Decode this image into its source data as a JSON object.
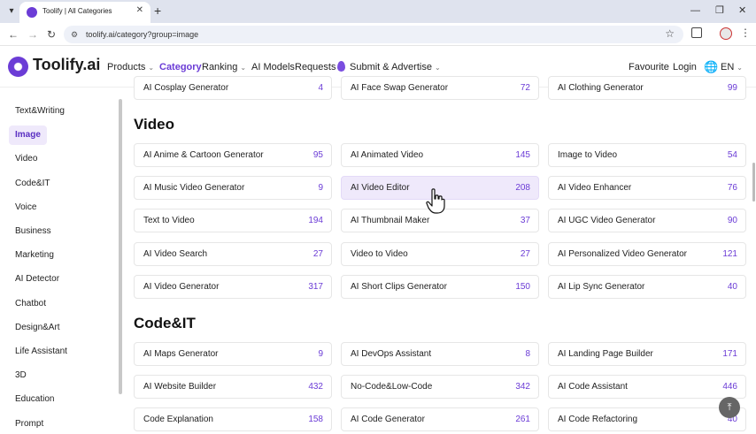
{
  "browser": {
    "tab_title": "Toolify | All Categories",
    "url": "toolify.ai/category?group=image",
    "icons": {
      "tab_menu": "chevron-down-icon",
      "close": "close-icon",
      "new_tab": "plus-icon",
      "back": "arrow-left-icon",
      "forward": "arrow-right-icon",
      "reload": "reload-icon",
      "site_info": "tune-icon",
      "bookmark": "star-icon",
      "extensions": "puzzle-icon",
      "menu": "kebab-icon"
    }
  },
  "header": {
    "logo_text": "Toolify.ai",
    "nav": {
      "products": "Products",
      "category": "Category",
      "ranking": "Ranking",
      "ai_models": "AI Models",
      "requests": "Requests",
      "submit": "Submit & Advertise"
    },
    "favourite": "Favourite",
    "login": "Login",
    "language": "EN",
    "accent_color": "#6b3cd6"
  },
  "sidebar": {
    "items": [
      {
        "label": "Text&Writing",
        "active": false
      },
      {
        "label": "Image",
        "active": true
      },
      {
        "label": "Video",
        "active": false
      },
      {
        "label": "Code&IT",
        "active": false
      },
      {
        "label": "Voice",
        "active": false
      },
      {
        "label": "Business",
        "active": false
      },
      {
        "label": "Marketing",
        "active": false
      },
      {
        "label": "AI Detector",
        "active": false
      },
      {
        "label": "Chatbot",
        "active": false
      },
      {
        "label": "Design&Art",
        "active": false
      },
      {
        "label": "Life Assistant",
        "active": false
      },
      {
        "label": "3D",
        "active": false
      },
      {
        "label": "Education",
        "active": false
      },
      {
        "label": "Prompt",
        "active": false
      }
    ]
  },
  "top_row": [
    {
      "name": "AI Cosplay Generator",
      "count": "4"
    },
    {
      "name": "AI Face Swap Generator",
      "count": "72"
    },
    {
      "name": "AI Clothing Generator",
      "count": "99"
    }
  ],
  "sections": {
    "video": {
      "title": "Video",
      "cards": [
        {
          "name": "AI Anime & Cartoon Generator",
          "count": "95"
        },
        {
          "name": "AI Animated Video",
          "count": "145"
        },
        {
          "name": "Image to Video",
          "count": "54"
        },
        {
          "name": "AI Music Video Generator",
          "count": "9"
        },
        {
          "name": "AI Video Editor",
          "count": "208"
        },
        {
          "name": "AI Video Enhancer",
          "count": "76"
        },
        {
          "name": "Text to Video",
          "count": "194"
        },
        {
          "name": "AI Thumbnail Maker",
          "count": "37"
        },
        {
          "name": "AI UGC Video Generator",
          "count": "90"
        },
        {
          "name": "AI Video Search",
          "count": "27"
        },
        {
          "name": "Video to Video",
          "count": "27"
        },
        {
          "name": "AI Personalized Video Generator",
          "count": "121"
        },
        {
          "name": "AI Video Generator",
          "count": "317"
        },
        {
          "name": "AI Short Clips Generator",
          "count": "150"
        },
        {
          "name": "AI Lip Sync Generator",
          "count": "40"
        }
      ]
    },
    "code": {
      "title": "Code&IT",
      "cards": [
        {
          "name": "AI Maps Generator",
          "count": "9"
        },
        {
          "name": "AI DevOps Assistant",
          "count": "8"
        },
        {
          "name": "AI Landing Page Builder",
          "count": "171"
        },
        {
          "name": "AI Website Builder",
          "count": "432"
        },
        {
          "name": "No-Code&Low-Code",
          "count": "342"
        },
        {
          "name": "AI Code Assistant",
          "count": "446"
        },
        {
          "name": "Code Explanation",
          "count": "158"
        },
        {
          "name": "AI Code Generator",
          "count": "261"
        },
        {
          "name": "AI Code Refactoring",
          "count": "40"
        }
      ]
    }
  }
}
